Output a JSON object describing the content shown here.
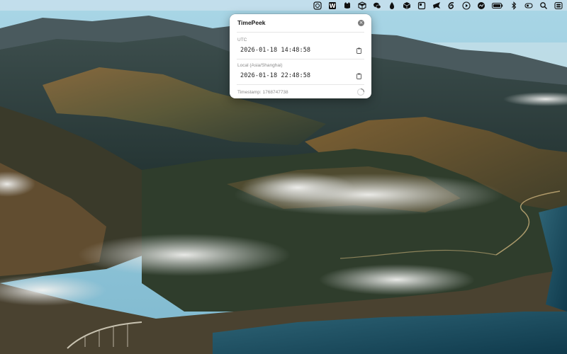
{
  "app": {
    "title": "TimePeek",
    "close_label": "×"
  },
  "fields": [
    {
      "label": "UTC",
      "value": "2026-01-18 14:48:58",
      "copy_icon": "clipboard-icon"
    },
    {
      "label": "Local (Asia/Shanghai)",
      "value": "2026-01-18 22:48:58",
      "copy_icon": "clipboard-icon"
    }
  ],
  "footer": {
    "timestamp": "Timestamp: 1768747738",
    "refresh_icon": "spinner-icon"
  },
  "menubar": {
    "icons": [
      "timepeek-clock-icon",
      "w-app-icon",
      "cat-app-icon",
      "box-icon",
      "wechat-icon",
      "drop-icon",
      "cube-icon",
      "window-icon",
      "bird-app-icon",
      "swirl-app-icon",
      "play-icon",
      "dashboard-icon",
      "battery-icon",
      "bluetooth-icon",
      "vpn-icon",
      "search-icon",
      "control-center-icon"
    ]
  },
  "colors": {
    "popover_bg": "#ffffff",
    "menubar_bg": "#d7e6f0",
    "sky": "#8fc3d6",
    "ocean": "#1c4e63"
  }
}
